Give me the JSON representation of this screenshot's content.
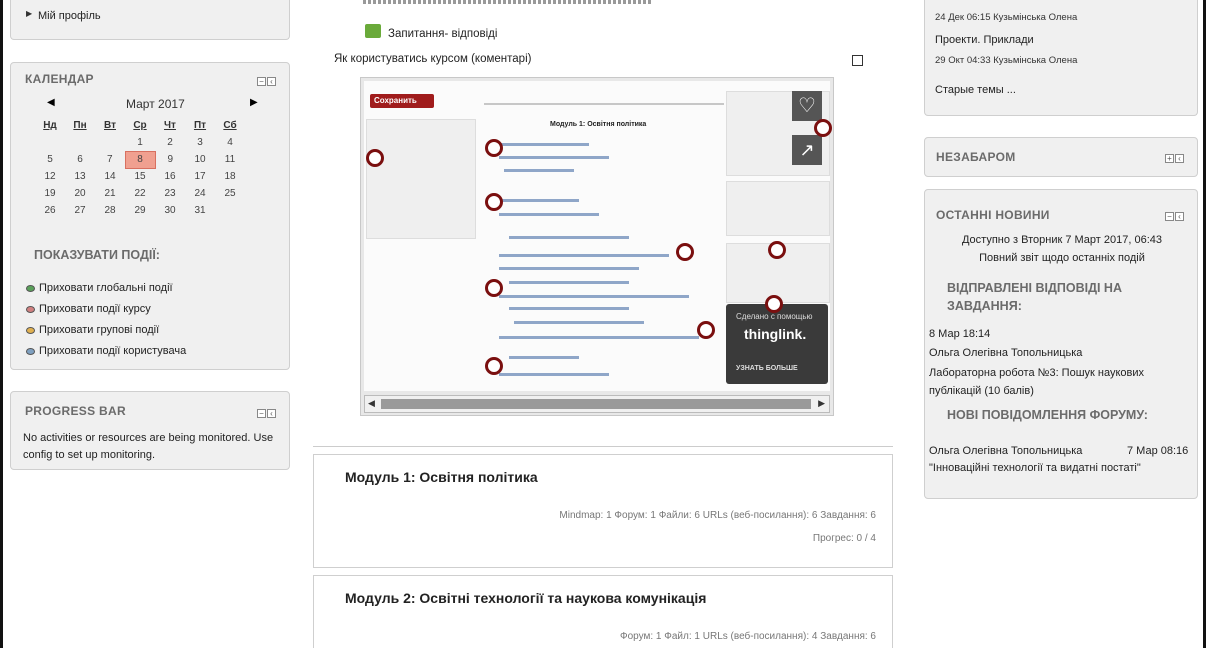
{
  "left": {
    "profile_link": "Мій профіль",
    "calendar": {
      "title": "КАЛЕНДАР",
      "month": "Март 2017",
      "weekdays": [
        "Нд",
        "Пн",
        "Вт",
        "Ср",
        "Чт",
        "Пт",
        "Сб"
      ],
      "weeks": [
        [
          "",
          "",
          "",
          "1",
          "2",
          "3",
          "4"
        ],
        [
          "5",
          "6",
          "7",
          "8",
          "9",
          "10",
          "11"
        ],
        [
          "12",
          "13",
          "14",
          "15",
          "16",
          "17",
          "18"
        ],
        [
          "19",
          "20",
          "21",
          "22",
          "23",
          "24",
          "25"
        ],
        [
          "26",
          "27",
          "28",
          "29",
          "30",
          "31",
          ""
        ]
      ],
      "today": "8",
      "events_heading": "ПОКАЗУВАТИ ПОДІЇ:",
      "events": [
        {
          "label": "Приховати глобальні події",
          "color": "#5aa05a"
        },
        {
          "label": "Приховати події курсу",
          "color": "#d08080"
        },
        {
          "label": "Приховати групові події",
          "color": "#e0b050"
        },
        {
          "label": "Приховати події користувача",
          "color": "#7fa0c0"
        }
      ]
    },
    "progress": {
      "title": "PROGRESS BAR",
      "message": "No activities or resources are being monitored. Use config to set up monitoring."
    }
  },
  "center": {
    "qa_link": "Запитання- відповіді",
    "usage_label": "Як користуватись курсом (коментарі)",
    "thinglink": {
      "save_label": "Сохранить",
      "made_with": "Сделано с помощью",
      "brand": "thinglink.",
      "learn_more": "УЗНАТЬ БОЛЬШЕ",
      "module_heading": "Модуль 1: Освітня політика"
    },
    "modules": [
      {
        "title": "Модуль 1: Освітня політика",
        "stats": "Mindmap: 1 Форум: 1 Файли: 6 URLs (веб-посилання): 6 Завдання: 6",
        "progress": "Прогрес: 0 / 4"
      },
      {
        "title": "Модуль 2: Освітні технології та наукова комунікація",
        "stats": "Форум: 1 Файл: 1 URLs (веб-посилання): 4 Завдання: 6"
      }
    ]
  },
  "right": {
    "recent": {
      "items": [
        {
          "meta": "24 Дек 06:15 Кузьмінська Олена"
        },
        {
          "title": "Проекти. Приклади",
          "meta": "29 Окт 04:33 Кузьмінська Олена"
        }
      ],
      "older": "Старые темы ..."
    },
    "soon": {
      "title": "НЕЗАБАРОМ"
    },
    "news": {
      "title": "ОСТАННІ НОВИНИ",
      "available_from": "Доступно з Вторник 7 Март 2017, 06:43",
      "full_report": "Повний звіт щодо останніх подій",
      "submitted_heading": "ВІДПРАВЛЕНІ ВІДПОВІДІ НА ЗАВДАННЯ:",
      "submission": {
        "date": "8 Мар 18:14",
        "author": "Ольга Олегівна Топольницька",
        "task": "Лабораторна робота №3: Пошук наукових публікацій (10 балів)"
      },
      "forum_heading": "НОВІ ПОВІДОМЛЕННЯ ФОРУМУ:",
      "post": {
        "author": "Ольга Олегівна Топольницька",
        "date": "7 Мар 08:16",
        "title": "\"Інноваційні технології та видатні постаті\""
      }
    }
  }
}
